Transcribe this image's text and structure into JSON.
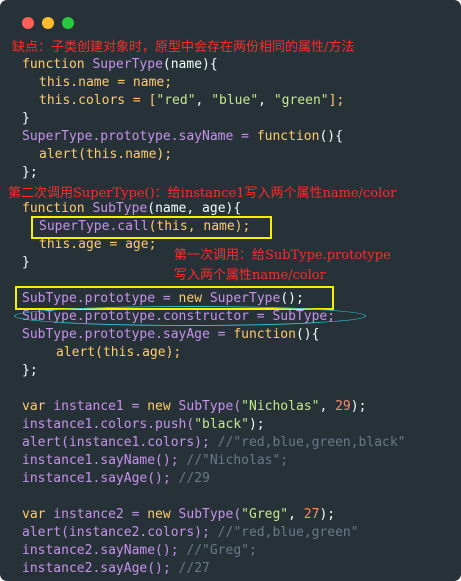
{
  "window": {
    "controls": [
      "close",
      "minimize",
      "maximize"
    ]
  },
  "annotations": {
    "top_note": "缺点：子类创建对象时，原型中会存在两份相同的属性/方法",
    "second_call_note": "第二次调用SuperType()：给instance1写入两个属性name/color",
    "first_call_note_line1": "第一次调用：给SubType.prototype",
    "first_call_note_line2": "写入两个属性name/color"
  },
  "code_lines": {
    "l1": {
      "k": "function",
      "n": "SuperType",
      "p": "(name){"
    },
    "l2": {
      "t": "this.name = name;"
    },
    "l3a": "this.colors = [",
    "l3s1": "\"red\"",
    "l3s2": "\"blue\"",
    "l3s3": "\"green\"",
    "l3b": "];",
    "l4": "}",
    "l5a": "SuperType.prototype.sayName = ",
    "l5b": "function",
    "l5c": "(){",
    "l6": "alert(this.name);",
    "l7": "};",
    "l8a": "function",
    "l8b": "SubType",
    "l8c": "(name, age){",
    "l9a": "SuperType.call",
    "l9b": "(this, name);",
    "l10": "this.age = age;",
    "l11": "}",
    "l12a": "SubType.prototype = ",
    "l12b": "new",
    "l12c": "SuperType",
    "l12d": "();",
    "l13": "SubType.prototype.constructor = SubType;",
    "l14a": "SubType.prototype.sayAge = ",
    "l14b": "function",
    "l14c": "(){",
    "l15": "alert(this.age);",
    "l16": "};",
    "l17a": "var",
    "l17b": " instance1 = ",
    "l17c": "new",
    "l17d": " SubType(",
    "l17e": "\"Nicholas\"",
    "l17f": ", ",
    "l17g": "29",
    "l17h": ");",
    "l18a": "instance1.colors.push(",
    "l18b": "\"black\"",
    "l18c": ");",
    "l19a": "alert(instance1.colors); ",
    "l19b": "//\"red,blue,green,black\"",
    "l20a": "instance1.sayName(); ",
    "l20b": "//\"Nicholas\";",
    "l21a": "instance1.sayAge(); ",
    "l21b": "//29",
    "l22a": "var",
    "l22b": " instance2 = ",
    "l22c": "new",
    "l22d": " SubType(",
    "l22e": "\"Greg\"",
    "l22f": ", ",
    "l22g": "27",
    "l22h": ");",
    "l23a": "alert(instance2.colors); ",
    "l23b": "//\"red,blue,green\"",
    "l24a": "instance2.sayName(); ",
    "l24b": "//\"Greg\";",
    "l25a": "instance2.sayAge(); ",
    "l25b": "//27"
  },
  "colors": {
    "background": "#263238",
    "keyword": "#ffcb6b",
    "function_name": "#c792ea",
    "string": "#c3e88d",
    "number": "#f78c6c",
    "comment": "#697987",
    "annotation_text": "#ff2a2a",
    "highlight_box": "#f4f000",
    "ellipse": "#30c7d7"
  }
}
